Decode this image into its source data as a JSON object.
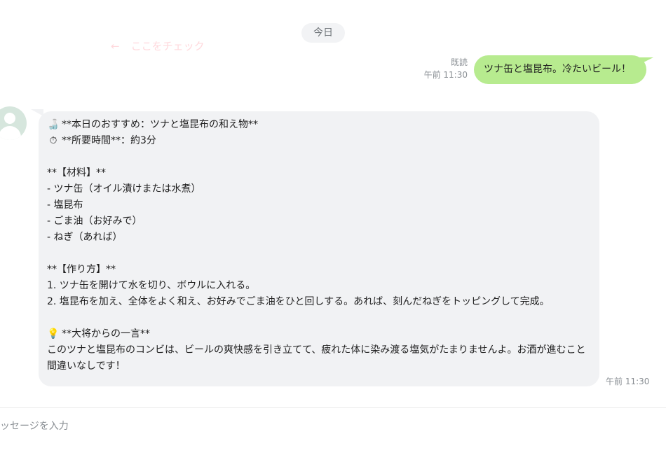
{
  "date_divider": "今日",
  "check_hint": {
    "arrow": "←",
    "text": "ここをチェック"
  },
  "outgoing": {
    "read_label": "既読",
    "time": "午前 11:30",
    "text": "ツナ缶と塩昆布。冷たいビール！"
  },
  "incoming": {
    "time": "午前 11:30",
    "lines": [
      {
        "icon": "🍶",
        "text": "**本日のおすすめ：ツナと塩昆布の和え物**"
      },
      {
        "icon": "⏱",
        "text": "**所要時間**：約3分"
      },
      {
        "text": ""
      },
      {
        "text": "**【材料】**"
      },
      {
        "text": "- ツナ缶（オイル漬けまたは水煮）"
      },
      {
        "text": "- 塩昆布"
      },
      {
        "text": "- ごま油（お好みで）"
      },
      {
        "text": "- ねぎ（あれば）"
      },
      {
        "text": ""
      },
      {
        "text": "**【作り方】**"
      },
      {
        "text": "1. ツナ缶を開けて水を切り、ボウルに入れる。"
      },
      {
        "text": "2. 塩昆布を加え、全体をよく和え、お好みでごま油をひと回しする。あれば、刻んだねぎをトッピングして完成。"
      },
      {
        "text": ""
      },
      {
        "icon": "💡",
        "text": "**大将からの一言**"
      },
      {
        "text": "このツナと塩昆布のコンビは、ビールの爽快感を引き立てて、疲れた体に染み渡る塩気がたまりませんよ。お酒が進むこと間違いなしです！"
      }
    ]
  },
  "composer": {
    "placeholder": "メッセージを入力"
  },
  "colors": {
    "outgoing_bubble": "#b7eb8f",
    "incoming_bubble": "#f1f2f4",
    "hint": "#ffd9dd"
  },
  "icons": {
    "avatar": "default-user-avatar",
    "recipe": "sake-bottle-icon",
    "timer": "stopwatch-icon",
    "tip": "light-bulb-icon"
  }
}
